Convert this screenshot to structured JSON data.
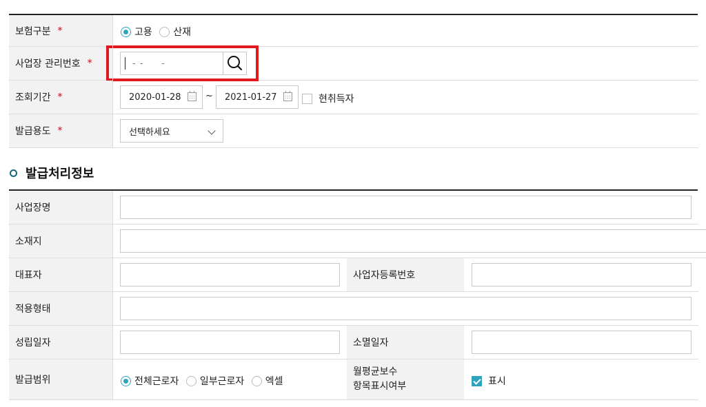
{
  "colors": {
    "accent": "#2ea3bd",
    "required": "#d0021b",
    "highlight": "#e0191e",
    "section_bullet": "#16637a"
  },
  "search_form": {
    "insurance_type": {
      "label": "보험구분",
      "required": "*",
      "options": [
        "고용",
        "산재"
      ],
      "selected": "고용"
    },
    "biz_mgmt_no": {
      "label": "사업장 관리번호",
      "required": "*",
      "value": "- -     -",
      "search_icon": "search-icon"
    },
    "period": {
      "label": "조회기간",
      "required": "*",
      "from": "2020-01-28",
      "to": "2021-01-27",
      "separator": "~",
      "current_acquirer": "현취득자"
    },
    "purpose": {
      "label": "발급용도",
      "required": "*",
      "placeholder": "선택하세요"
    }
  },
  "section": {
    "title": "발급처리정보"
  },
  "info": {
    "biz_name": "사업장명",
    "location": "소재지",
    "representative": "대표자",
    "biz_reg_no": "사업자등록번호",
    "apply_type": "적용형태",
    "established": "성립일자",
    "extinguished": "소멸일자",
    "issue_scope": {
      "label": "발급범위",
      "options": [
        "전체근로자",
        "일부근로자",
        "엑셀"
      ],
      "selected": "전체근로자"
    },
    "avg_wage": {
      "label_line1": "월평균보수",
      "label_line2": "항목표시여부",
      "checkbox_label": "표시",
      "checked": true
    }
  }
}
